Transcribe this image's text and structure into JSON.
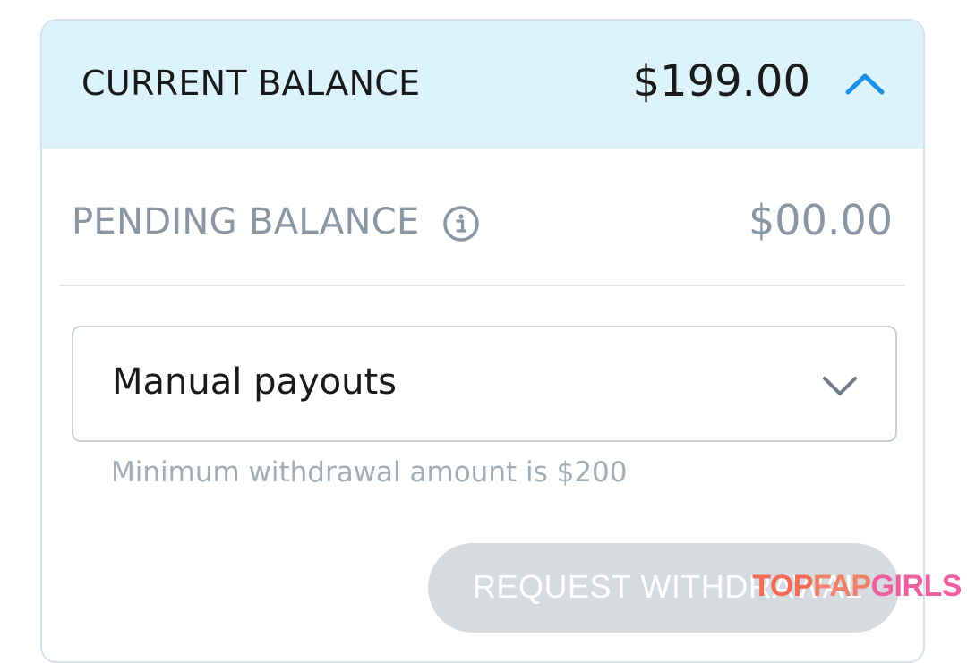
{
  "balance": {
    "current_label": "CURRENT BALANCE",
    "current_amount": "$199.00",
    "pending_label": "PENDING BALANCE",
    "pending_amount": "$00.00"
  },
  "payout": {
    "selected": "Manual payouts",
    "helper": "Minimum withdrawal amount is $200"
  },
  "actions": {
    "request_withdrawal": "REQUEST WITHDRAWAL"
  },
  "watermark": {
    "part1": "TOP",
    "part2": "FAP",
    "part3": "GIRLS"
  },
  "colors": {
    "header_bg": "#dcf3fb",
    "accent": "#1a8fe3",
    "muted": "#8a96a3",
    "button_disabled": "#d7dbdf"
  },
  "icons": {
    "collapse": "chevron-up-icon",
    "info": "info-icon",
    "dropdown": "chevron-down-icon"
  }
}
